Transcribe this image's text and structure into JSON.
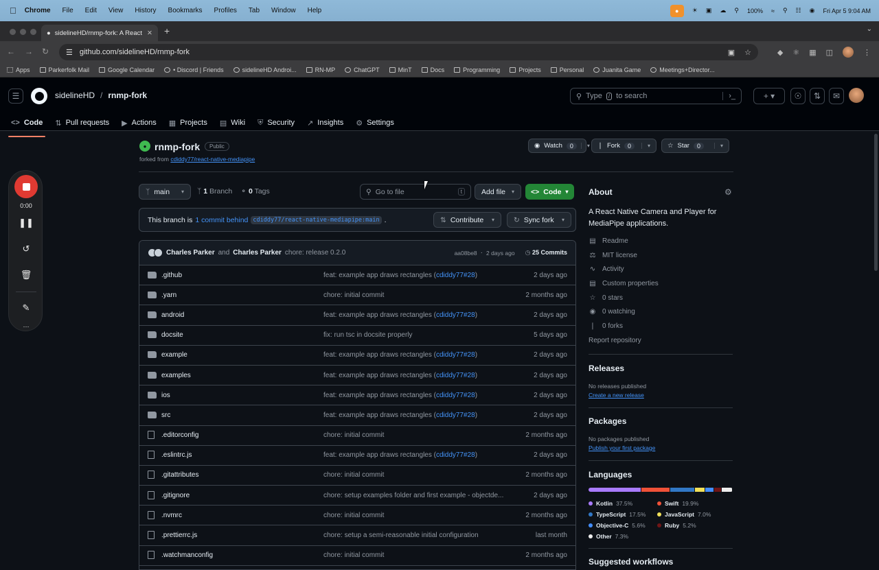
{
  "menubar": {
    "app": "Chrome",
    "items": [
      "File",
      "Edit",
      "View",
      "History",
      "Bookmarks",
      "Profiles",
      "Tab",
      "Window",
      "Help"
    ],
    "battery": "100%",
    "datetime": "Fri Apr 5  9:04 AM"
  },
  "browser": {
    "tab_title": "sidelineHD/rnmp-fork: A React",
    "url": "github.com/sidelineHD/rnmp-fork",
    "bookmarks": [
      "Apps",
      "Parkerfolk Mail",
      "Google Calendar",
      "• Discord | Friends",
      "sidelineHD Androi...",
      "RN-MP",
      "ChatGPT",
      "MinT",
      "Docs",
      "Programming",
      "Projects",
      "Personal",
      "Juanita Game",
      "Meetings+Director..."
    ]
  },
  "github": {
    "owner": "sidelineHD",
    "repo": "rnmp-fork",
    "search_prefix": "Type",
    "search_key": "/",
    "search_suffix": "to search",
    "nav": [
      "Code",
      "Pull requests",
      "Actions",
      "Projects",
      "Wiki",
      "Security",
      "Insights",
      "Settings"
    ]
  },
  "recorder": {
    "time": "0:00"
  },
  "repo": {
    "name": "rnmp-fork",
    "visibility": "Public",
    "forked_from_label": "forked from",
    "forked_from": "cdiddy77/react-native-mediapipe",
    "watch": {
      "label": "Watch",
      "count": "0"
    },
    "fork": {
      "label": "Fork",
      "count": "0"
    },
    "star": {
      "label": "Star",
      "count": "0"
    },
    "branch": "main",
    "branches_count": "1",
    "branches_label": "Branch",
    "tags_count": "0",
    "tags_label": "Tags",
    "go_to_file": "Go to file",
    "go_to_file_key": "t",
    "add_file": "Add file",
    "code_button": "Code",
    "behind_prefix": "This branch is",
    "behind_link": "1 commit behind",
    "behind_ref": "cdiddy77/react-native-mediapipe:main",
    "behind_suffix": ".",
    "contribute": "Contribute",
    "sync_fork": "Sync fork"
  },
  "commit": {
    "author1": "Charles Parker",
    "and": "and",
    "author2": "Charles Parker",
    "message": "chore: release 0.2.0",
    "sha": "aa08be8",
    "dot": "·",
    "when": "2 days ago",
    "commits_count": "25 Commits"
  },
  "files": [
    {
      "type": "dir",
      "name": ".github",
      "msg": "feat: example app draws rectangles (",
      "ref": "cdiddy77#28",
      "end": ")",
      "ago": "2 days ago"
    },
    {
      "type": "dir",
      "name": ".yarn",
      "msg": "chore: initial commit",
      "ref": "",
      "end": "",
      "ago": "2 months ago"
    },
    {
      "type": "dir",
      "name": "android",
      "msg": "feat: example app draws rectangles (",
      "ref": "cdiddy77#28",
      "end": ")",
      "ago": "2 days ago"
    },
    {
      "type": "dir",
      "name": "docsite",
      "msg": "fix: run tsc in docsite properly",
      "ref": "",
      "end": "",
      "ago": "5 days ago"
    },
    {
      "type": "dir",
      "name": "example",
      "msg": "feat: example app draws rectangles (",
      "ref": "cdiddy77#28",
      "end": ")",
      "ago": "2 days ago"
    },
    {
      "type": "dir",
      "name": "examples",
      "msg": "feat: example app draws rectangles (",
      "ref": "cdiddy77#28",
      "end": ")",
      "ago": "2 days ago"
    },
    {
      "type": "dir",
      "name": "ios",
      "msg": "feat: example app draws rectangles (",
      "ref": "cdiddy77#28",
      "end": ")",
      "ago": "2 days ago"
    },
    {
      "type": "dir",
      "name": "src",
      "msg": "feat: example app draws rectangles (",
      "ref": "cdiddy77#28",
      "end": ")",
      "ago": "2 days ago"
    },
    {
      "type": "file",
      "name": ".editorconfig",
      "msg": "chore: initial commit",
      "ref": "",
      "end": "",
      "ago": "2 months ago"
    },
    {
      "type": "file",
      "name": ".eslintrc.js",
      "msg": "feat: example app draws rectangles (",
      "ref": "cdiddy77#28",
      "end": ")",
      "ago": "2 days ago"
    },
    {
      "type": "file",
      "name": ".gitattributes",
      "msg": "chore: initial commit",
      "ref": "",
      "end": "",
      "ago": "2 months ago"
    },
    {
      "type": "file",
      "name": ".gitignore",
      "msg": "chore: setup examples folder and first example - objectde...",
      "ref": "",
      "end": "",
      "ago": "2 days ago"
    },
    {
      "type": "file",
      "name": ".nvmrc",
      "msg": "chore: initial commit",
      "ref": "",
      "end": "",
      "ago": "2 months ago"
    },
    {
      "type": "file",
      "name": ".prettierrc.js",
      "msg": "chore: setup a semi-reasonable initial configuration",
      "ref": "",
      "end": "",
      "ago": "last month"
    },
    {
      "type": "file",
      "name": ".watchmanconfig",
      "msg": "chore: initial commit",
      "ref": "",
      "end": "",
      "ago": "2 months ago"
    }
  ],
  "about": {
    "title": "About",
    "description": "A React Native Camera and Player for MediaPipe applications.",
    "links": [
      "Readme",
      "MIT license",
      "Activity",
      "Custom properties",
      "0 stars",
      "0 watching",
      "0 forks"
    ],
    "report": "Report repository"
  },
  "releases": {
    "title": "Releases",
    "none": "No releases published",
    "link": "Create a new release"
  },
  "packages": {
    "title": "Packages",
    "none": "No packages published",
    "link": "Publish your first package"
  },
  "languages": {
    "title": "Languages",
    "items": [
      {
        "name": "Kotlin",
        "pct": "37.5%",
        "value": 37.5,
        "color": "#a97bff"
      },
      {
        "name": "Swift",
        "pct": "19.9%",
        "value": 19.9,
        "color": "#f05138"
      },
      {
        "name": "TypeScript",
        "pct": "17.5%",
        "value": 17.5,
        "color": "#3178c6"
      },
      {
        "name": "JavaScript",
        "pct": "7.0%",
        "value": 7.0,
        "color": "#f1e05a"
      },
      {
        "name": "Objective-C",
        "pct": "5.6%",
        "value": 5.6,
        "color": "#438eff"
      },
      {
        "name": "Ruby",
        "pct": "5.2%",
        "value": 5.2,
        "color": "#701516"
      },
      {
        "name": "Other",
        "pct": "7.3%",
        "value": 7.3,
        "color": "#ededed"
      }
    ]
  },
  "workflows": {
    "title": "Suggested workflows"
  }
}
